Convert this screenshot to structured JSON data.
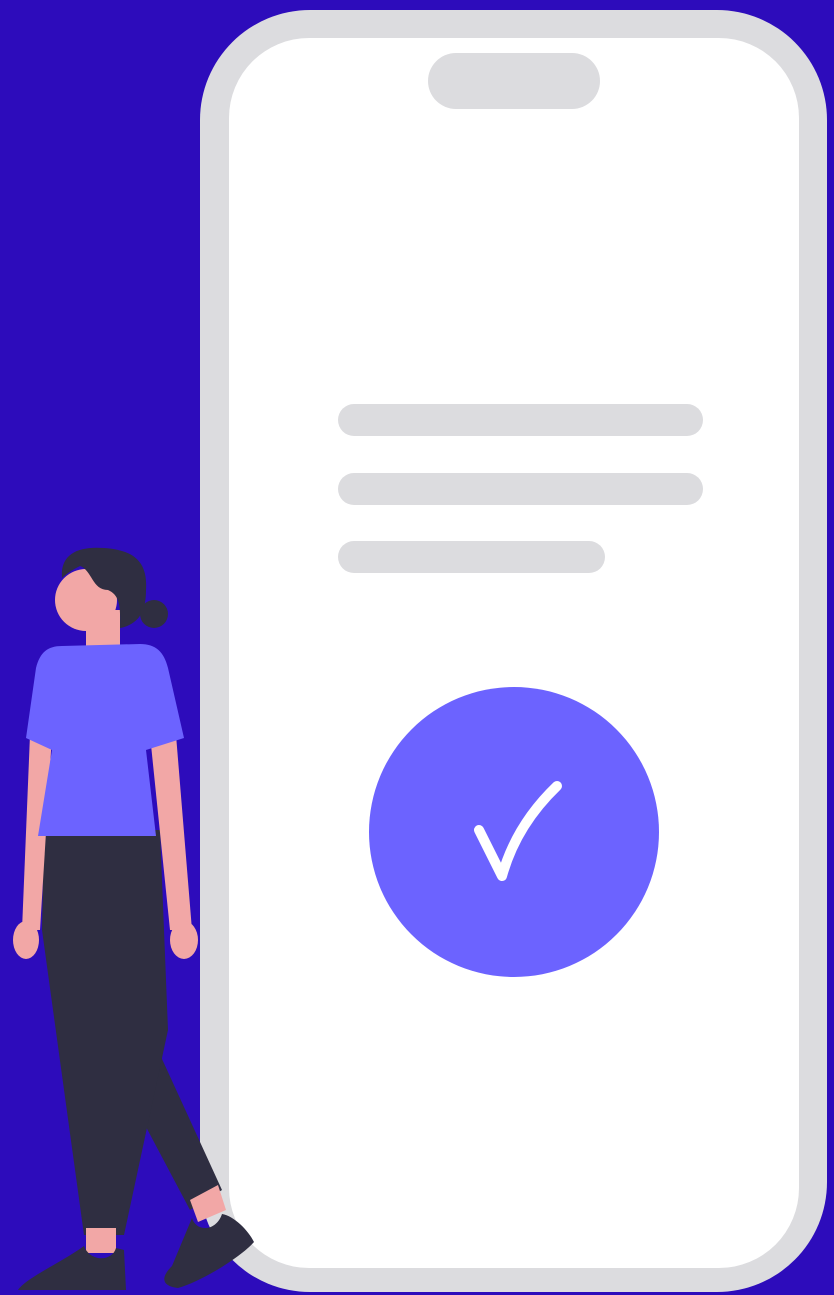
{
  "colors": {
    "background": "#2d0cbb",
    "phone_frame": "#dcdcdf",
    "phone_screen": "#ffffff",
    "placeholder_line": "#dcdcdf",
    "check_circle": "#6c63ff",
    "check_mark": "#ffffff",
    "skin": "#f2a7a6",
    "hair": "#2f2e41",
    "shirt": "#6c63ff",
    "pants": "#2f2e41",
    "shoes": "#2f2e41"
  },
  "icons": {
    "status": "check-icon",
    "person": "person-illustration"
  },
  "progress": {
    "state": "success"
  }
}
